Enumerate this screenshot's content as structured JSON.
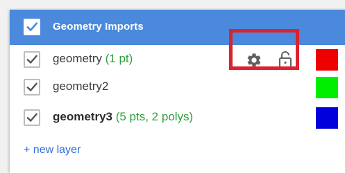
{
  "header": {
    "title": "Geometry Imports",
    "checked": true
  },
  "layers": [
    {
      "name": "geometry",
      "count": "(1 pt)",
      "color": "#ee0000",
      "checked": true,
      "bold": false
    },
    {
      "name": "geometry2",
      "count": "",
      "color": "#00ee00",
      "checked": true,
      "bold": false
    },
    {
      "name": "geometry3",
      "count": "(5 pts, 2 polys)",
      "color": "#0000dd",
      "checked": true,
      "bold": true
    }
  ],
  "row_icons": {
    "settings": "gear-icon",
    "lock": "lock-open-icon"
  },
  "new_layer_label": "+ new layer",
  "colors": {
    "header_bg": "#4a89dc",
    "highlight": "#d9232f",
    "count_text": "#2e9e3e",
    "link": "#2f6fd6"
  }
}
